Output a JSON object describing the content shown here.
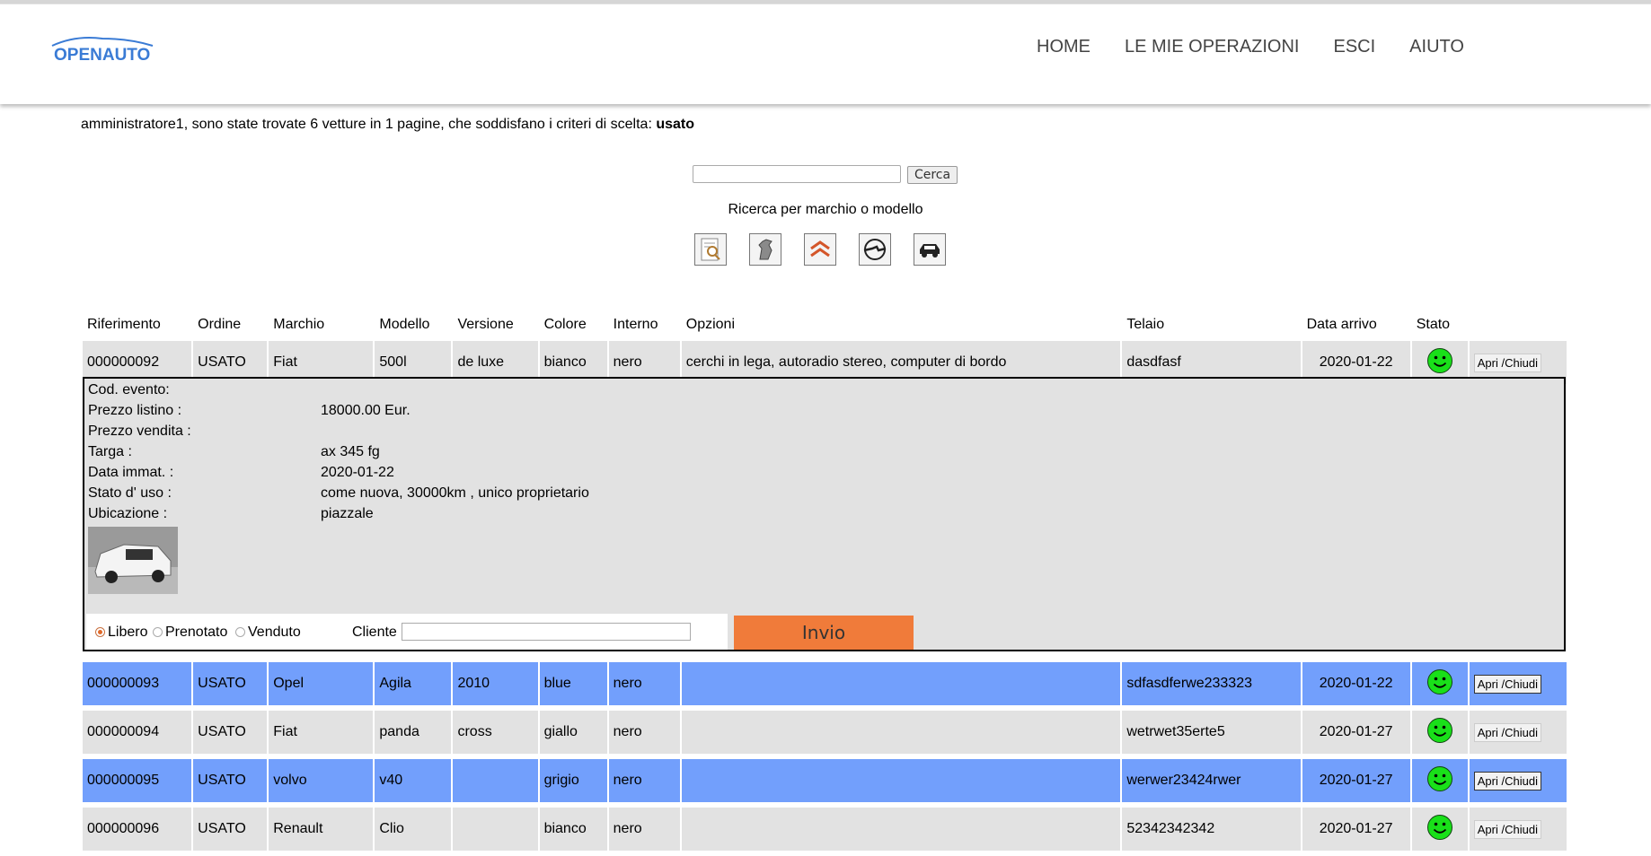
{
  "brand": {
    "logo_text": "OPENAUTO"
  },
  "nav": [
    "HOME",
    "LE MIE OPERAZIONI",
    "ESCI",
    "AIUTO"
  ],
  "summary": {
    "text": "amministratore1, sono state trovate 6 vetture in 1 pagine, che soddisfano i criteri di scelta: ",
    "criteria": "usato"
  },
  "search": {
    "button": "Cerca",
    "caption": "Ricerca per marchio o modello",
    "value": ""
  },
  "brand_icons": [
    "search-list-icon",
    "peugeot-logo-icon",
    "citroen-logo-icon",
    "opel-logo-icon",
    "car-icon"
  ],
  "table": {
    "headers": [
      "Riferimento",
      "Ordine",
      "Marchio",
      "Modello",
      "Versione",
      "Colore",
      "Interno",
      "Opzioni",
      "Telaio",
      "Data arrivo",
      "Stato",
      ""
    ],
    "button_label": "Apri /Chiudi",
    "rows": [
      {
        "ref": "000000092",
        "ordine": "USATO",
        "marchio": "Fiat",
        "modello": "500l",
        "versione": "de luxe",
        "colore": "bianco",
        "interno": "nero",
        "opzioni": "cerchi in lega, autoradio stereo, computer di bordo",
        "telaio": "dasdfasf",
        "data": "2020-01-22",
        "stato": "green-smiley-icon"
      },
      {
        "ref": "000000093",
        "ordine": "USATO",
        "marchio": "Opel",
        "modello": "Agila",
        "versione": "2010",
        "colore": "blue",
        "interno": "nero",
        "opzioni": "",
        "telaio": "sdfasdferwe233323",
        "data": "2020-01-22",
        "stato": "green-smiley-icon"
      },
      {
        "ref": "000000094",
        "ordine": "USATO",
        "marchio": "Fiat",
        "modello": "panda",
        "versione": "cross",
        "colore": "giallo",
        "interno": "nero",
        "opzioni": "",
        "telaio": "wetrwet35erte5",
        "data": "2020-01-27",
        "stato": "green-smiley-icon"
      },
      {
        "ref": "000000095",
        "ordine": "USATO",
        "marchio": "volvo",
        "modello": "v40",
        "versione": "",
        "colore": "grigio",
        "interno": "nero",
        "opzioni": "",
        "telaio": "werwer23424rwer",
        "data": "2020-01-27",
        "stato": "green-smiley-icon"
      },
      {
        "ref": "000000096",
        "ordine": "USATO",
        "marchio": "Renault",
        "modello": "Clio",
        "versione": "",
        "colore": "bianco",
        "interno": "nero",
        "opzioni": "",
        "telaio": "52342342342",
        "data": "2020-01-27",
        "stato": "green-smiley-icon"
      }
    ]
  },
  "detail": {
    "fields": [
      {
        "label": "Cod. evento:",
        "value": ""
      },
      {
        "label": "Prezzo listino :",
        "value": "18000.00 Eur."
      },
      {
        "label": "Prezzo vendita :",
        "value": ""
      },
      {
        "label": "Targa :",
        "value": "ax 345 fg"
      },
      {
        "label": "Data immat. :",
        "value": "2020-01-22"
      },
      {
        "label": "Stato d' uso :",
        "value": "come nuova, 30000km , unico proprietario"
      },
      {
        "label": "Ubicazione :",
        "value": "piazzale"
      }
    ],
    "radio": [
      {
        "label": "Libero",
        "checked": true
      },
      {
        "label": "Prenotato",
        "checked": false
      },
      {
        "label": "Venduto",
        "checked": false
      }
    ],
    "cliente_label": "Cliente",
    "cliente_value": "",
    "submit": "Invio",
    "accent": "#f07b3a"
  },
  "colors": {
    "row_gray": "#e2e2e2",
    "row_blue": "#729ffc",
    "status_green": "#19e019"
  }
}
